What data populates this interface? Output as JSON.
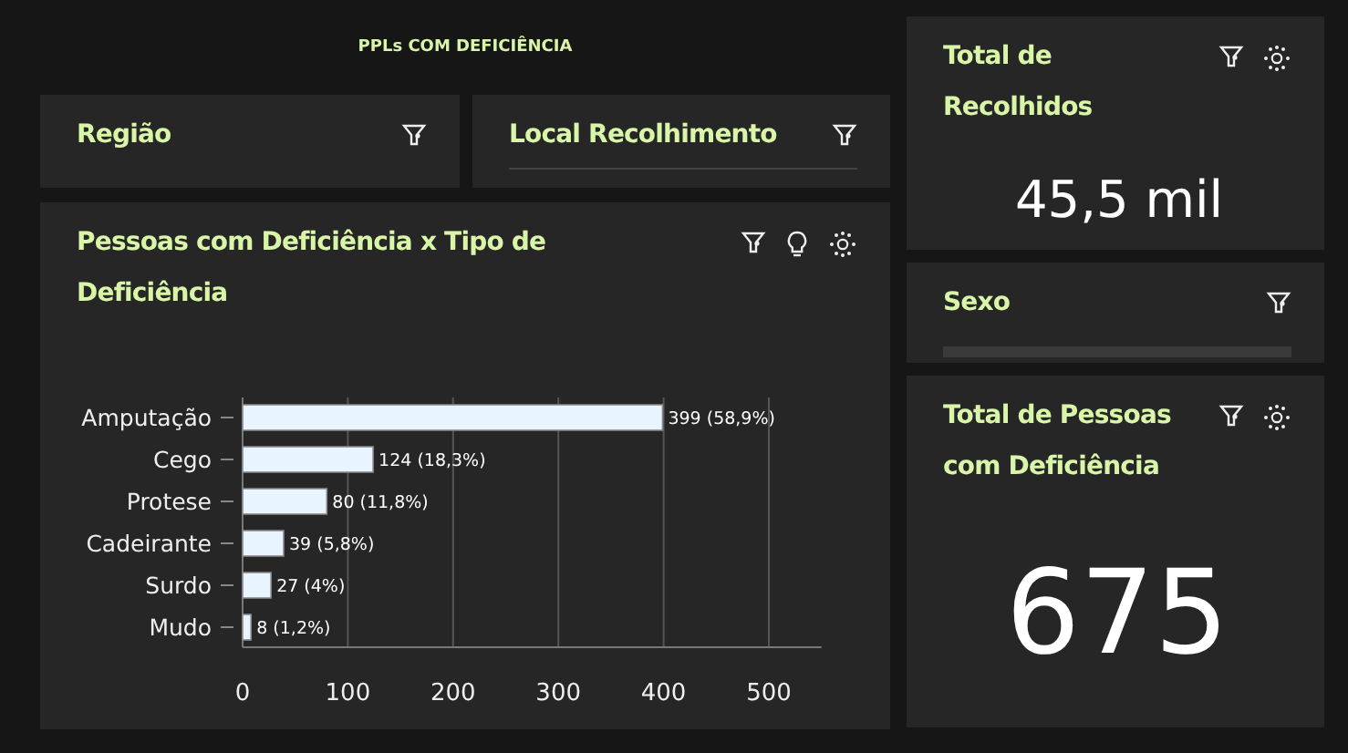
{
  "page_title": "PPLs COM DEFICIÊNCIA",
  "filters": [
    {
      "kind": "filter",
      "title": "Região"
    },
    {
      "kind": "filter-divider",
      "title": "Local Recolhimento"
    }
  ],
  "chart_panel": {
    "title": "Pessoas com Deficiência x Tipo de Deficiência",
    "chart_data": {
      "type": "bar",
      "orientation": "horizontal",
      "grid": true,
      "categories": [
        "Amputação",
        "Cego",
        "Protese",
        "Cadeirante",
        "Surdo",
        "Mudo"
      ],
      "series": [
        {
          "color": "#e8f4ff",
          "values": [
            399,
            124,
            80,
            39,
            27,
            8
          ]
        }
      ],
      "value_labels": [
        "399 (58,9%)",
        "124 (18,3%)",
        "80 (11,8%)",
        "39 (5,8%)",
        "27 (4%)",
        "8 (1,2%)"
      ],
      "xlim": [
        0,
        550
      ],
      "xticks": [
        0,
        100,
        200,
        300,
        400,
        500
      ]
    }
  },
  "side_panels": [
    {
      "kind": "kpi",
      "title": "Total de Recolhidos",
      "value": "45,5 mil"
    },
    {
      "kind": "filter-bar",
      "title": "Sexo"
    },
    {
      "kind": "kpi-large",
      "title": "Total de Pessoas com Deficiência",
      "value": "675"
    }
  ]
}
